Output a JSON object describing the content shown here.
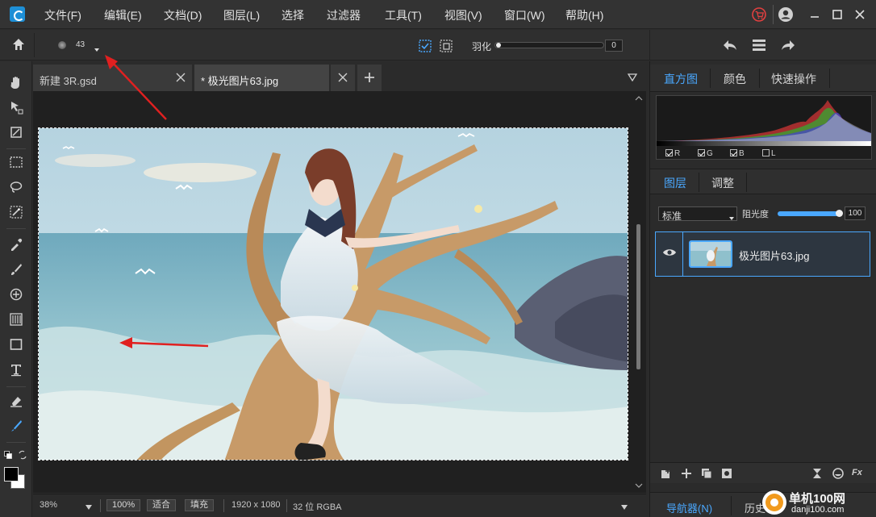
{
  "menubar": {
    "items": [
      "文件(F)",
      "编辑(E)",
      "文档(D)",
      "图层(L)",
      "选择",
      "过滤器",
      "工具(T)",
      "视图(V)",
      "窗口(W)",
      "帮助(H)"
    ]
  },
  "options": {
    "brush_size": "43",
    "feather_label": "羽化",
    "feather_value": "0"
  },
  "tabs": [
    {
      "label": "新建 3R.gsd",
      "active": false
    },
    {
      "label": "* 极光图片63.jpg",
      "active": true
    }
  ],
  "status": {
    "zoom": "38%",
    "zoom_100": "100%",
    "fit": "适合",
    "fill": "填充",
    "dimensions": "1920 x 1080",
    "color_mode": "32 位 RGBA"
  },
  "histogram_panel": {
    "tabs": [
      "直方图",
      "颜色",
      "快速操作"
    ],
    "channels": [
      {
        "label": "R",
        "checked": true
      },
      {
        "label": "G",
        "checked": true
      },
      {
        "label": "B",
        "checked": true
      },
      {
        "label": "L",
        "checked": false
      }
    ]
  },
  "layers_panel": {
    "tabs": [
      "图层",
      "调整"
    ],
    "blend_mode": "标准",
    "opacity_label": "阻光度",
    "opacity_value": "100",
    "layers": [
      {
        "name": "极光图片63.jpg",
        "visible": true,
        "selected": true
      }
    ]
  },
  "bottom_tabs": [
    "导航器(N)",
    "历史"
  ],
  "watermark": {
    "name": "单机100网",
    "url": "danji100.com"
  },
  "colors": {
    "accent": "#4aa8ff",
    "selection_blue": "#1e8fd6",
    "annotation_arrow": "#e02020"
  },
  "icons": {
    "toolbar": [
      "home-icon",
      "brush-size-dot-icon",
      "dropdown-icon",
      "select-mode-icon",
      "select-mode-alt-icon"
    ],
    "history": [
      "undo-icon",
      "menu-icon",
      "redo-icon"
    ],
    "tools": [
      "hand-icon",
      "move-icon",
      "crop-icon",
      "marquee-icon",
      "lasso-icon",
      "magic-select-icon",
      "eyedropper-icon",
      "brush-icon",
      "stamp-icon",
      "gradient-icon",
      "shape-icon",
      "text-icon",
      "eraser-icon",
      "pen-icon"
    ]
  }
}
